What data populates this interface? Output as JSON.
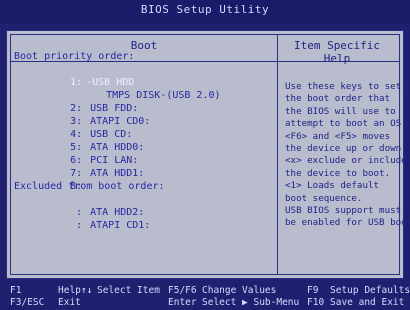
{
  "window": {
    "title": "BIOS Setup Utility"
  },
  "headers": {
    "boot": "Boot",
    "help": "Item Specific Help"
  },
  "boot_section": {
    "priority_title": "Boot priority order:",
    "priority_rows": [
      {
        "num": "1:",
        "value": "-USB HDD"
      },
      {
        "num": "",
        "value": "TMPS DISK-(USB 2.0)"
      },
      {
        "num": "2:",
        "value": "USB FDD:"
      },
      {
        "num": "3:",
        "value": "ATAPI CD0:"
      },
      {
        "num": "4:",
        "value": "USB CD:"
      },
      {
        "num": "5:",
        "value": "ATA HDD0:"
      },
      {
        "num": "6:",
        "value": "PCI LAN:"
      },
      {
        "num": "7:",
        "value": "ATA HDD1:"
      },
      {
        "num": "8:",
        "value": ""
      }
    ],
    "excluded_title": "Excluded from boot order:",
    "excluded_rows": [
      {
        "num": ":",
        "value": "ATA HDD2:"
      },
      {
        "num": ":",
        "value": "ATAPI CD1:"
      }
    ]
  },
  "help_lines": [
    "Use these keys to set",
    "the boot order that",
    "the BIOS will use to",
    "attempt to boot an OS:",
    "<F6> and <F5> moves",
    "the device up or down.",
    "<x> exclude or include",
    "the device to boot.",
    "<1> Loads default",
    "boot sequence.",
    "USB BIOS support must",
    "be enabled for USB boot."
  ],
  "footer": {
    "row1": {
      "f1": "F1",
      "help": "Help",
      "arrows": "↑↓",
      "select_item": "Select Item",
      "f5f6": "F5/F6",
      "change_values": "Change Values",
      "f9": "F9",
      "setup_defaults": "Setup Defaults"
    },
    "row2": {
      "f3esc": "F3/ESC",
      "exit": "Exit",
      "enter": "Enter",
      "select_submenu": "Select ▶ Sub-Menu",
      "f10": "F10",
      "save_exit": "Save and Exit"
    }
  },
  "colors": {
    "background": "#1f2170",
    "panel": "#b9bccd",
    "item_text": "#2629a0",
    "selected_text": "#f0f0ff"
  }
}
